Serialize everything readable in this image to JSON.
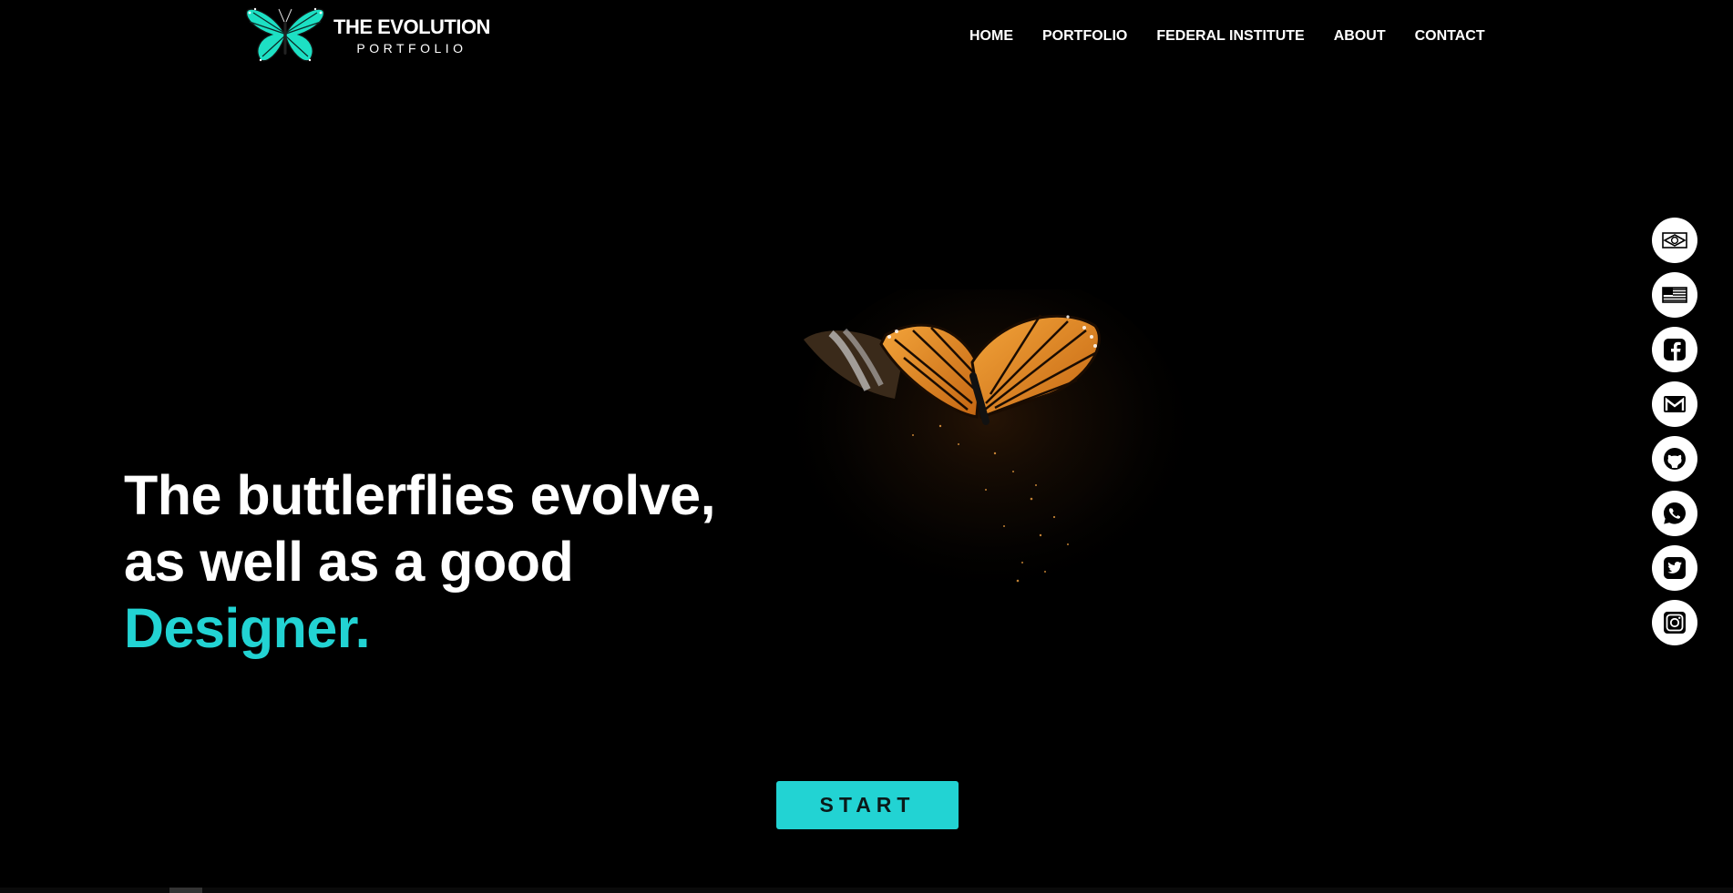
{
  "brand": {
    "title": "THE EVOLUTION",
    "subtitle": "PORTFOLIO",
    "logo_icon": "butterfly-logo-icon",
    "logo_color": "#22e0c8"
  },
  "nav": {
    "items": [
      {
        "label": "HOME"
      },
      {
        "label": "PORTFOLIO"
      },
      {
        "label": "FEDERAL INSTITUTE"
      },
      {
        "label": "ABOUT"
      },
      {
        "label": "CONTACT"
      }
    ]
  },
  "hero": {
    "line1": "The buttlerflies evolve,",
    "line2": "as well as a good",
    "accent_word": "Designer.",
    "accent_color": "#22d3d3",
    "image_icon": "monarch-butterfly-image",
    "cta_label": "START"
  },
  "social": {
    "items": [
      {
        "icon": "brazil-flag-icon"
      },
      {
        "icon": "usa-flag-icon"
      },
      {
        "icon": "facebook-icon"
      },
      {
        "icon": "gmail-icon"
      },
      {
        "icon": "github-icon"
      },
      {
        "icon": "whatsapp-icon"
      },
      {
        "icon": "twitter-icon"
      },
      {
        "icon": "instagram-icon"
      }
    ]
  }
}
